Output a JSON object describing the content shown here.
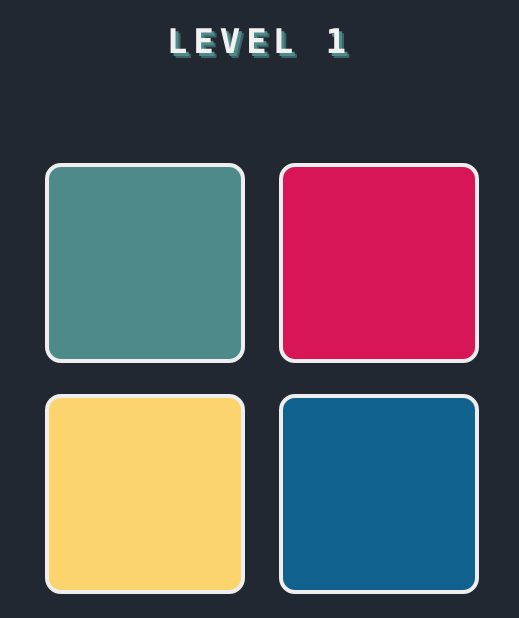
{
  "header": {
    "level_label": "LEVEL 1"
  },
  "tiles": [
    {
      "id": "tile-1",
      "color": "#4f8a8b"
    },
    {
      "id": "tile-2",
      "color": "#d71657"
    },
    {
      "id": "tile-3",
      "color": "#fbd46d"
    },
    {
      "id": "tile-4",
      "color": "#11618f"
    }
  ]
}
